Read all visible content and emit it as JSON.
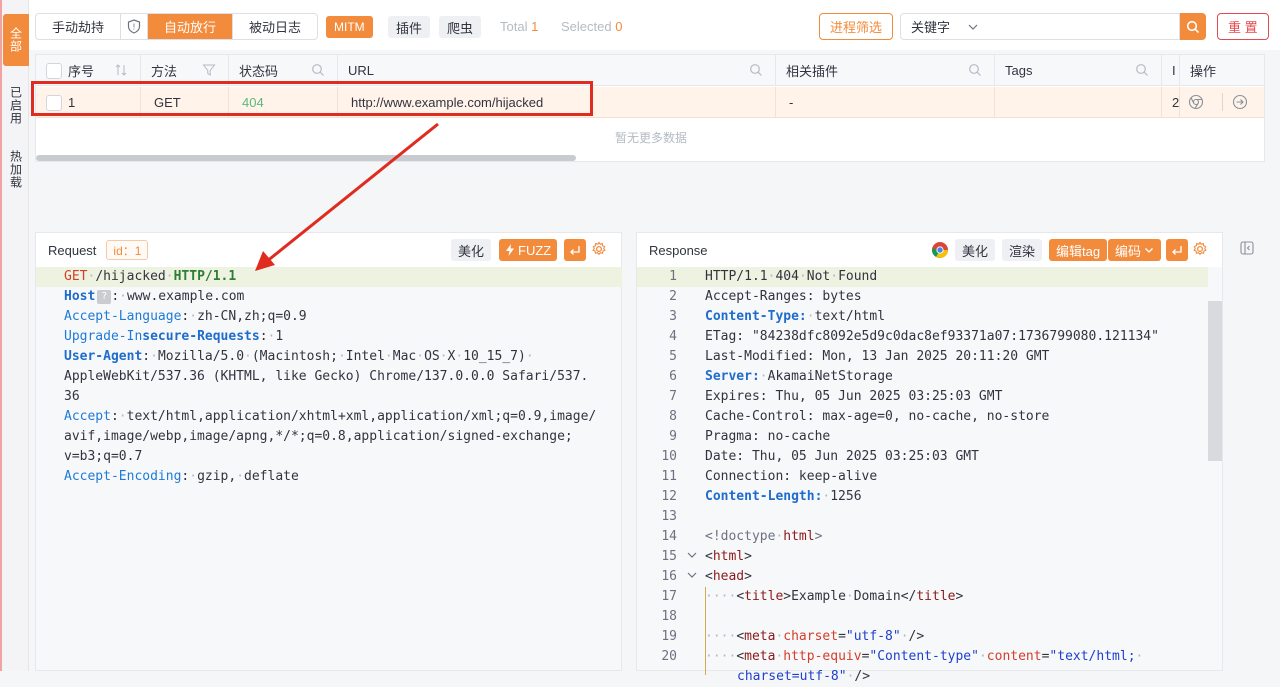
{
  "sidebar_tabs": [
    "全部",
    "已启用",
    "热加载"
  ],
  "toolbar": {
    "mode_buttons": [
      "手动劫持",
      "自动放行",
      "被动日志"
    ],
    "mitm": "MITM",
    "plugin": "插件",
    "crawler": "爬虫",
    "total_label": "Total",
    "total_value": "1",
    "selected_label": "Selected",
    "selected_value": "0",
    "process_filter": "进程筛选",
    "keyword_select": "关键字",
    "search_placeholder": "",
    "reset": "重 置"
  },
  "table": {
    "columns": [
      "序号",
      "方法",
      "状态码",
      "URL",
      "相关插件",
      "Tags",
      "I",
      "操作"
    ],
    "rows": [
      {
        "index": "1",
        "method": "GET",
        "status": "404",
        "url": "http://www.example.com/hijacked",
        "plugins": "-",
        "tags": "",
        "i": "2"
      }
    ],
    "empty_text": "暂无更多数据"
  },
  "request": {
    "title": "Request",
    "id_tag": "id：1",
    "beautify": "美化",
    "fuzz": "FUZZ",
    "lines": [
      "GET /hijacked HTTP/1.1",
      "Host: www.example.com",
      "Accept-Language: zh-CN,zh;q=0.9",
      "Upgrade-Insecure-Requests: 1",
      "User-Agent: Mozilla/5.0 (Macintosh; Intel Mac OS X 10_15_7)",
      "AppleWebKit/537.36 (KHTML, like Gecko) Chrome/137.0.0.0 Safari/537.",
      "36",
      "Accept: text/html,application/xhtml+xml,application/xml;q=0.9,image/",
      "avif,image/webp,image/apng,*/*;q=0.8,application/signed-exchange;",
      "v=b3;q=0.7",
      "Accept-Encoding: gzip, deflate"
    ]
  },
  "response": {
    "title": "Response",
    "beautify": "美化",
    "render": "渲染",
    "edit_tag": "编辑tag",
    "encoding": "编码",
    "line_numbers": [
      "1",
      "2",
      "3",
      "4",
      "5",
      "6",
      "7",
      "8",
      "9",
      "10",
      "11",
      "12",
      "13",
      "14",
      "15",
      "16",
      "17",
      "18",
      "19",
      "20"
    ],
    "lines": [
      "HTTP/1.1 404 Not Found",
      "Accept-Ranges: bytes",
      "Content-Type: text/html",
      "ETag: \"84238dfc8092e5d9c0dac8ef93371a07:1736799080.121134\"",
      "Last-Modified: Mon, 13 Jan 2025 20:11:20 GMT",
      "Server: AkamaiNetStorage",
      "Expires: Thu, 05 Jun 2025 03:25:03 GMT",
      "Cache-Control: max-age=0, no-cache, no-store",
      "Pragma: no-cache",
      "Date: Thu, 05 Jun 2025 03:25:03 GMT",
      "Connection: keep-alive",
      "Content-Length: 1256",
      "",
      "<!doctype html>",
      "<html>",
      "<head>",
      "<title>Example Domain</title>",
      "",
      "<meta charset=\"utf-8\" />",
      "<meta http-equiv=\"Content-type\" content=\"text/html;",
      "charset=utf-8\" />"
    ]
  }
}
